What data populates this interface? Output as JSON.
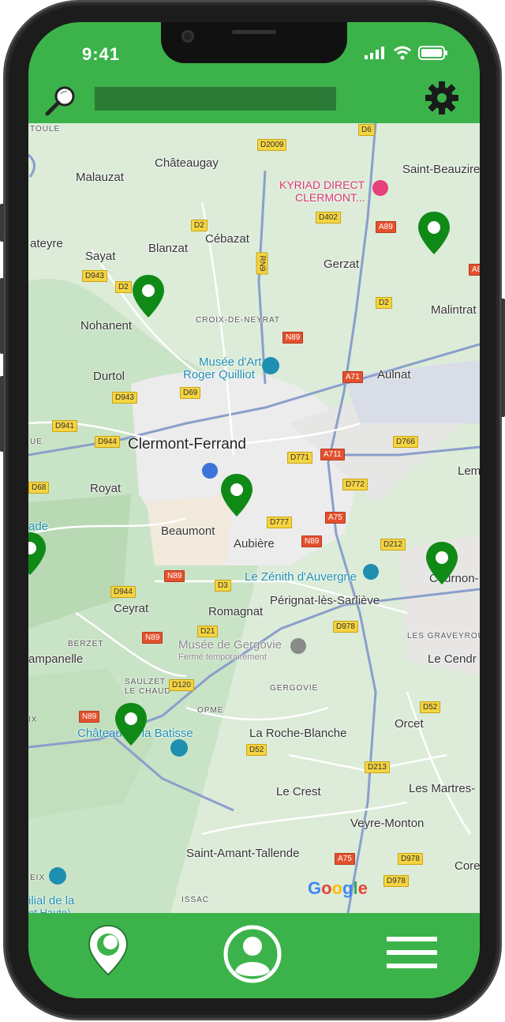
{
  "status": {
    "time": "9:41"
  },
  "header": {
    "search_value": "",
    "icons": [
      "search-icon",
      "gear-icon"
    ]
  },
  "colors": {
    "brand": "#3cb34a",
    "dark_green": "#2a7a36",
    "pin": "#0f8a17"
  },
  "map": {
    "places": {
      "toule": "TOULE",
      "chateaugay": "Châteaugay",
      "malauzat": "Malauzat",
      "saint_beauzire": "Saint-Beauzire",
      "kyriad1": "KYRIAD DIRECT",
      "kyriad2": "CLERMONT...",
      "cebazat": "Cébazat",
      "blanzat": "Blanzat",
      "ateyre": "ateyre",
      "sayat": "Sayat",
      "gerzat": "Gerzat",
      "malintrat": "Malintrat",
      "nohanent": "Nohanent",
      "croix": "CROIX-DE-NEYRAT",
      "musee1": "Musée d'Art",
      "musee2": "Roger Quilliot",
      "durtol": "Durtol",
      "aulnat": "Aulnat",
      "clermont": "Clermont-Ferrand",
      "ue": "UE",
      "lem": "Lem",
      "royat": "Royat",
      "ade": "ade",
      "beaumont": "Beaumont",
      "aubiere": "Aubière",
      "zenith": "Le Zénith d'Auvergne",
      "cournon": "Cournon-",
      "ceyrat": "Ceyrat",
      "perignat": "Pérignat-lès-Sarliève",
      "romagnat": "Romagnat",
      "berzet": "BERZET",
      "gergovie1": "Musée de Gergovie",
      "gergovie2": "Fermé temporairement",
      "graveyrou": "LES GRAVEYROU",
      "campanelle": "ampanelle",
      "cendre": "Le Cendr",
      "saulzet1": "SAULZET",
      "saulzet2": "LE CHAUD",
      "gergovie": "GERGOVIE",
      "opme": "OPME",
      "ix": "IX",
      "orcet": "Orcet",
      "batisse": "Château de la Batisse",
      "roche": "La Roche-Blanche",
      "crest": "Le Crest",
      "martres": "Les Martres-",
      "veyre": "Veyre-Monton",
      "saint_amant": "Saint-Amant-Tallende",
      "core": "Core",
      "eix": "EIX",
      "ilial1": "ilial de la",
      "ilial2": "et Haute)",
      "issac": "ISSAC"
    },
    "roads": {
      "d6": "D6",
      "d2009": "D2009",
      "a89": "A89",
      "a8": "A8",
      "d402": "D402",
      "d2a": "D2",
      "d2b": "D2",
      "d943a": "D943",
      "d2c": "D2",
      "rn9": "RN9",
      "n89a": "N89",
      "a71": "A71",
      "d69": "D69",
      "d943b": "D943",
      "d941": "D941",
      "d944a": "D944",
      "d771": "D771",
      "a711": "A711",
      "d766": "D766",
      "d68": "D68",
      "d772": "D772",
      "d777": "D777",
      "a75a": "A75",
      "n89b": "N89",
      "d212": "D212",
      "n89c": "N89",
      "d3": "D3",
      "d944b": "D944",
      "d978a": "D978",
      "d21": "D21",
      "n89d": "N89",
      "d120": "D120",
      "d52a": "D52",
      "n89e": "N89",
      "d52b": "D52",
      "d213": "D213",
      "a75b": "A75",
      "d978b": "D978",
      "d978c": "D978"
    },
    "attribution": "Google"
  },
  "bottom_nav": [
    "map-pin-icon",
    "profile-icon",
    "menu-icon"
  ]
}
